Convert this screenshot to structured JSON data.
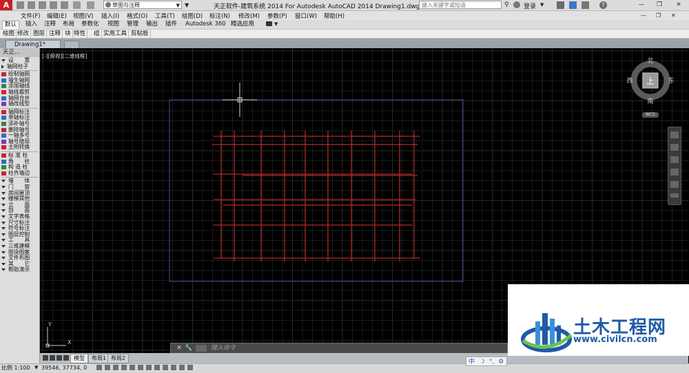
{
  "titlebar": {
    "app_logo": "A",
    "workspace": "草图与注释",
    "window_title": "天正软件-建筑系统 2014  For Autodesk AutoCAD 2014    Drawing1.dwg",
    "search_placeholder": "键入关键字或短语",
    "login": "登录",
    "help_label": "?"
  },
  "menubar": {
    "items": [
      "文件(F)",
      "编辑(E)",
      "视图(V)",
      "插入(I)",
      "格式(O)",
      "工具(T)",
      "绘图(D)",
      "标注(N)",
      "修改(M)",
      "参数(P)",
      "窗口(W)",
      "帮助(H)"
    ]
  },
  "ribbon": {
    "tabs": [
      "默认",
      "插入",
      "注释",
      "布局",
      "参数化",
      "视图",
      "管理",
      "输出",
      "插件",
      "Autodesk 360",
      "精选应用"
    ],
    "panels": [
      "绘图",
      "修改",
      "图层",
      "注释",
      "块",
      "特性",
      "组",
      "实用工具",
      "剪贴板"
    ]
  },
  "document": {
    "tab": "Drawing1*"
  },
  "palette": {
    "title": "天正...",
    "groups": [
      {
        "items": [
          {
            "label": "设　　置",
            "kind": "cat",
            "icon": "triangle-right-icon"
          },
          {
            "label": "轴网柱子",
            "kind": "cat-open",
            "icon": "triangle-down-icon"
          }
        ]
      },
      {
        "items": [
          {
            "label": "绘制轴网",
            "kind": "tool",
            "icon": "grid-icon"
          },
          {
            "label": "墙生轴网",
            "kind": "tool",
            "icon": "wall-grid-icon"
          },
          {
            "label": "添加轴线",
            "kind": "tool",
            "icon": "add-axis-icon"
          },
          {
            "label": "轴线裁剪",
            "kind": "tool",
            "icon": "trim-axis-icon"
          },
          {
            "label": "轴网合并",
            "kind": "tool",
            "icon": "merge-grid-icon"
          },
          {
            "label": "轴改线型",
            "kind": "tool",
            "icon": "linetype-icon"
          }
        ]
      },
      {
        "items": [
          {
            "label": "轴网标注",
            "kind": "tool",
            "icon": "grid-dim-icon"
          },
          {
            "label": "单轴标注",
            "kind": "tool",
            "icon": "single-axis-dim-icon"
          },
          {
            "label": "添补轴号",
            "kind": "tool",
            "icon": "add-axis-number-icon"
          },
          {
            "label": "删除轴号",
            "kind": "tool",
            "icon": "delete-axis-number-icon"
          },
          {
            "label": "一轴多号",
            "kind": "tool",
            "icon": "multi-number-icon"
          },
          {
            "label": "轴号隐现",
            "kind": "tool",
            "icon": "toggle-number-icon"
          },
          {
            "label": "主附转换",
            "kind": "tool",
            "icon": "convert-icon"
          }
        ]
      },
      {
        "items": [
          {
            "label": "标 准 柱",
            "kind": "tool",
            "icon": "column-icon"
          },
          {
            "label": "角　　柱",
            "kind": "tool",
            "icon": "corner-column-icon"
          },
          {
            "label": "构 造 柱",
            "kind": "tool",
            "icon": "structural-column-icon"
          },
          {
            "label": "柱齐墙边",
            "kind": "tool",
            "icon": "align-column-icon"
          }
        ]
      },
      {
        "items": [
          {
            "label": "墙　　体",
            "kind": "cat",
            "icon": "triangle-right-icon"
          },
          {
            "label": "门　　窗",
            "kind": "cat",
            "icon": "triangle-right-icon"
          },
          {
            "label": "房间屋顶",
            "kind": "cat",
            "icon": "triangle-right-icon"
          },
          {
            "label": "楼梯其他",
            "kind": "cat",
            "icon": "triangle-right-icon"
          },
          {
            "label": "立　　面",
            "kind": "cat",
            "icon": "triangle-right-icon"
          },
          {
            "label": "剖　　面",
            "kind": "cat",
            "icon": "triangle-right-icon"
          },
          {
            "label": "文字表格",
            "kind": "cat",
            "icon": "triangle-right-icon"
          },
          {
            "label": "尺寸标注",
            "kind": "cat",
            "icon": "triangle-right-icon"
          },
          {
            "label": "符号标注",
            "kind": "cat",
            "icon": "triangle-right-icon"
          },
          {
            "label": "图层控制",
            "kind": "cat",
            "icon": "triangle-right-icon"
          },
          {
            "label": "工　　具",
            "kind": "cat",
            "icon": "triangle-right-icon"
          },
          {
            "label": "三维建模",
            "kind": "cat",
            "icon": "triangle-right-icon"
          },
          {
            "label": "图块图案",
            "kind": "cat",
            "icon": "triangle-right-icon"
          },
          {
            "label": "文件布图",
            "kind": "cat",
            "icon": "triangle-right-icon"
          },
          {
            "label": "其　　它",
            "kind": "cat",
            "icon": "triangle-right-icon"
          },
          {
            "label": "帮助演示",
            "kind": "cat",
            "icon": "triangle-right-icon"
          }
        ]
      }
    ]
  },
  "viewport": {
    "label": "[-][俯视][二维线框]",
    "compass": {
      "north": "北",
      "south": "南",
      "east": "东",
      "west": "西",
      "center": "上",
      "wcs": "WCS"
    },
    "ucs": {
      "x": "X",
      "y": "Y"
    },
    "colors": {
      "background": "#000000",
      "grid": "#1c1c1c",
      "grid_major": "#2a2a2a",
      "axis_lines": "#b02a2a",
      "boundary": "#4d4d9e"
    }
  },
  "command": {
    "placeholder": "键入命令"
  },
  "layout_tabs": [
    "模型",
    "布局1",
    "布局2"
  ],
  "status": {
    "scale": "比例 1:100",
    "coords": "39546, 37734, 0"
  },
  "watermark": {
    "title": "土木工程网",
    "url": "www.civilcn.com"
  },
  "ime": {
    "label": "中"
  }
}
